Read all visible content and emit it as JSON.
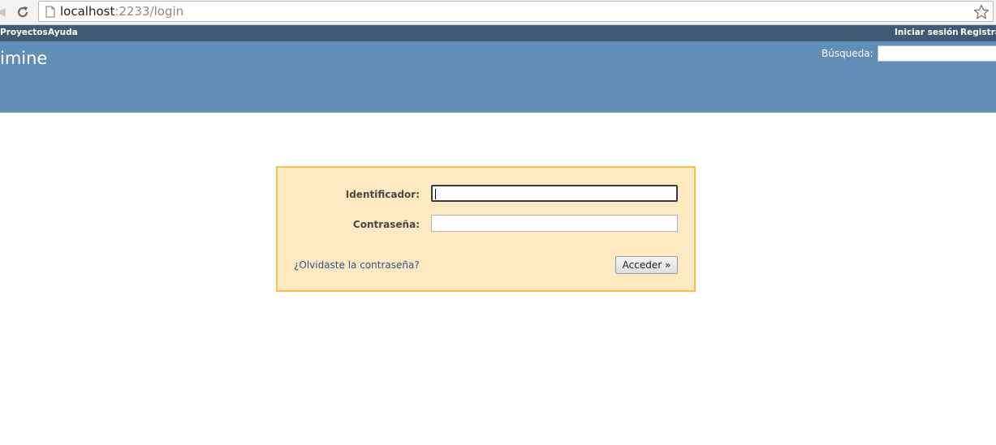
{
  "browser": {
    "url_host": "localhost",
    "url_rest": ":2233/login"
  },
  "top_menu": {
    "left": [
      "Proyectos",
      "Ayuda"
    ],
    "right": [
      "Iniciar sesión",
      "Registra"
    ]
  },
  "header": {
    "title": "imine",
    "search_label": "Búsqueda:"
  },
  "login": {
    "username_label": "Identificador:",
    "password_label": "Contraseña:",
    "username_value": "",
    "password_value": "",
    "lost_password": "¿Olvidaste la contraseña?",
    "submit": "Acceder »"
  },
  "colors": {
    "top_menu_bg": "#3e5b76",
    "header_bg": "#628db6",
    "login_bg": "#ffe9c2",
    "login_border": "#fdbf3b",
    "link": "#2a5685"
  }
}
